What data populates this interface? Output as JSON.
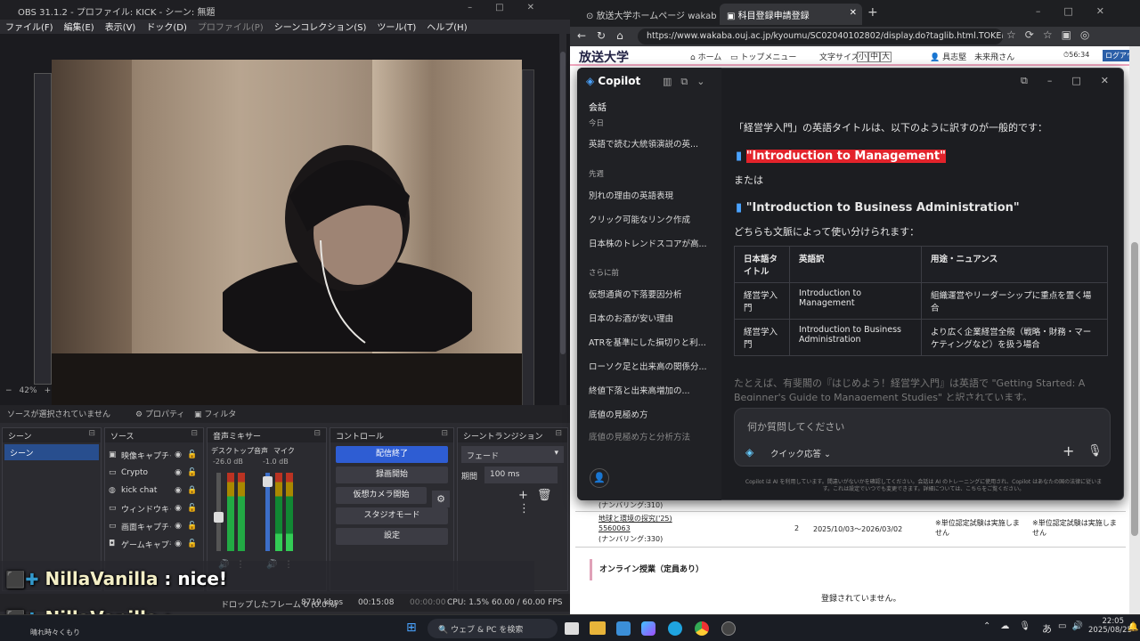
{
  "obs": {
    "title": "OBS 31.1.2 - プロファイル: KICK - シーン: 無題",
    "menu": [
      "ファイル(F)",
      "編集(E)",
      "表示(V)",
      "ドック(D)",
      "プロファイル(P)",
      "シーンコレクション(S)",
      "ツール(T)",
      "ヘルプ(H)"
    ],
    "zoom": "42%",
    "no_source": "ソースが選択されていません",
    "properties": "プロパティ",
    "filters": "フィルタ",
    "docks": {
      "scenes": {
        "title": "シーン",
        "items": [
          "シーン"
        ]
      },
      "sources": {
        "title": "ソース",
        "items": [
          {
            "name": "映像キャプチャデ",
            "icon": "camera-icon"
          },
          {
            "name": "Crypto",
            "icon": "window-icon"
          },
          {
            "name": "kick chat",
            "icon": "globe-icon"
          },
          {
            "name": "ウィンドウキャプ",
            "icon": "window-icon"
          },
          {
            "name": "画面キャプチャ",
            "icon": "monitor-icon"
          },
          {
            "name": "ゲームキャプチャ",
            "icon": "gamepad-icon"
          }
        ]
      },
      "mixer": {
        "title": "音声ミキサー",
        "ch1": "デスクトップ音声",
        "ch1_db": "-26.0 dB",
        "ch2": "マイク",
        "ch2_db": "-1.0 dB",
        "scale": [
          "0",
          "-5",
          "-10",
          "-15",
          "-20",
          "-25",
          "-30",
          "-35",
          "-40",
          "-45",
          "-50",
          "-55",
          "-60"
        ]
      },
      "controls": {
        "title": "コントロール",
        "buttons": [
          "配信終了",
          "録画開始",
          "仮想カメラ開始",
          "スタジオモード",
          "設定"
        ]
      },
      "transitions": {
        "title": "シーントランジション",
        "transition": "フェード",
        "duration_label": "期間",
        "duration": "100 ms"
      }
    },
    "status": {
      "dropped": "ドロップしたフレーム 0 (0.0%)",
      "kbps": "8719 kbps",
      "time": "00:15:08",
      "rec_time": "00:00:00",
      "cpu": "CPU: 1.5%",
      "fps": "60.00 / 60.00 FPS"
    }
  },
  "chat": {
    "line1_user": "NillaVanilla",
    "line1_msg": ": nice!",
    "line2_user": "NillaVanilla",
    "line2_msg": ":",
    "footer": "晴れ時々くもり"
  },
  "browser": {
    "tabs": [
      "放送大学ホームページ wakaba - 検索...",
      "科目登録申請登録"
    ],
    "url": "https://www.wakaba.ouj.ac.jp/kyoumu/SC02040102802/display.do?taglib.html.TOKEN...",
    "site": {
      "logo": "放送大学",
      "nav": [
        "ホーム",
        "トップメニュー"
      ],
      "font_size_label": "文字サイズ",
      "sizes": [
        "小",
        "中",
        "大"
      ],
      "user": "具志堅　未来飛さん",
      "timer": "56:34",
      "logout": "ログアウト"
    },
    "lower_table": {
      "row0": {
        "name": "(ナンバリング:310)"
      },
      "row1": {
        "name": "地球と環境の探究('25)",
        "code": "5560063",
        "numbering": "(ナンバリング:330)",
        "credits": "2",
        "period": "2025/10/03～2026/03/02",
        "note1": "※単位認定試験は実施しません",
        "note2": "※単位認定試験は実施しません"
      },
      "section": "オンライン授業（定員あり）",
      "empty": "登録されていません。"
    }
  },
  "copilot": {
    "title": "Copilot",
    "conv_header": "会話",
    "sections": [
      {
        "label": "今日",
        "items": [
          "英語で読む大統領演説の英..."
        ]
      },
      {
        "label": "先週",
        "items": [
          "別れの理由の英語表現",
          "クリック可能なリンク作成",
          "日本株のトレンドスコアが高..."
        ]
      },
      {
        "label": "さらに前",
        "items": [
          "仮想通貨の下落要因分析",
          "日本のお酒が安い理由",
          "ATRを基準にした損切りと利...",
          "ローソク足と出来高の関係分...",
          "終値下落と出来高増加の...",
          "底値の見極め方",
          "底値の見極め方と分析方法"
        ]
      }
    ],
    "intro": "「経営学入門」の英語タイトルは、以下のように訳すのが一般的です：",
    "opt1": "\"Introduction to Management\"",
    "or": "または",
    "opt2": "\"Introduction to Business Administration\"",
    "usage": "どちらも文脈によって使い分けられます：",
    "table": {
      "headers": [
        "日本語タイトル",
        "英語訳",
        "用途・ニュアンス"
      ],
      "rows": [
        [
          "経営学入門",
          "Introduction to Management",
          "組織運営やリーダーシップに重点を置く場合"
        ],
        [
          "経営学入門",
          "Introduction to Business Administration",
          "より広く企業経営全般（戦略・財務・マーケティングなど）を扱う場合"
        ]
      ]
    },
    "faded": "たとえば、有斐閣の『はじめよう！経営学入門』は英語で \"Getting Started: A Beginner's Guide to Management Studies\" と訳されています。",
    "input_placeholder": "何か質問してください",
    "mode": "クイック応答",
    "disclaimer": "Copilot は AI を利用しています。間違いがないかを確認してください。会話は AI のトレーニングに使用され、Copilot はあなたの国の法律に従います。これは設定でいつでも変更できます。詳細については、こちらをご覧ください。"
  },
  "taskbar": {
    "search": "ウェブ & PC を検索",
    "time": "22:05",
    "date": "2025/08/25",
    "ime": "あ"
  }
}
